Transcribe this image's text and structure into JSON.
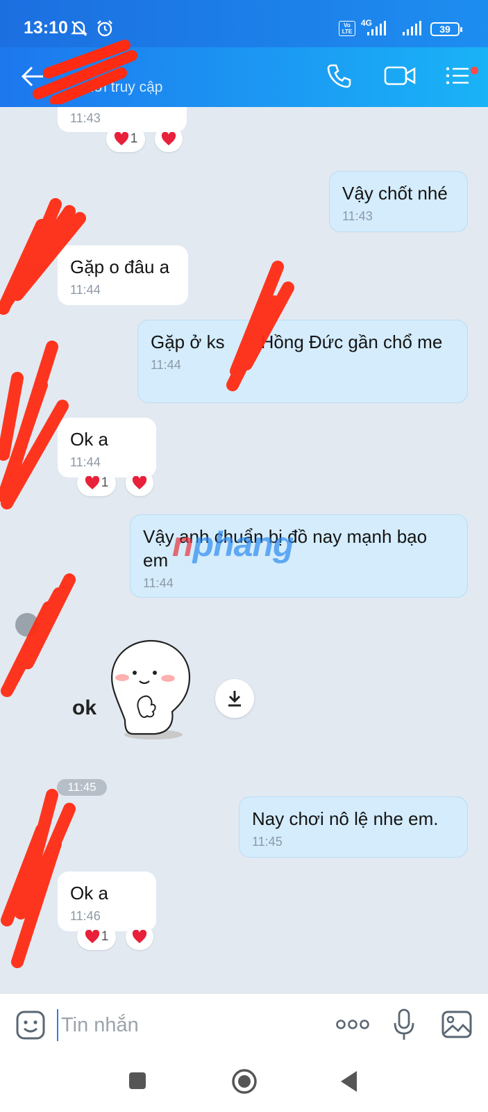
{
  "status_bar": {
    "time": "13:10",
    "network": "4G",
    "volte": "Vo LTE",
    "battery": "39"
  },
  "header": {
    "contact_name": "",
    "status": "mới truy cập"
  },
  "messages": [
    {
      "dir": "in",
      "time": "11:43",
      "reactions": {
        "count": "1"
      }
    },
    {
      "dir": "out",
      "text": "Vậy chốt nhé",
      "time": "11:43"
    },
    {
      "dir": "in",
      "text": "Gặp o đâu a",
      "time": "11:44"
    },
    {
      "dir": "out",
      "text_a": "Gặp ở ks",
      "text_b": "Hồng Đức gần chổ me",
      "time": "11:44"
    },
    {
      "dir": "in",
      "text": "Ok a",
      "time": "11:44",
      "reactions": {
        "count": "1"
      }
    },
    {
      "dir": "out",
      "text": "Vậy anh chuẩn bị đồ nay mạnh bạo em",
      "time": "11:44"
    },
    {
      "dir": "in",
      "type": "sticker",
      "sticker_text": "ok"
    },
    {
      "dir": "out",
      "text": "Nay chơi nô lệ nhe em.",
      "time": "11:45"
    },
    {
      "dir": "in",
      "text": "Ok a",
      "time": "11:46",
      "reactions": {
        "count": "1"
      }
    }
  ],
  "time_separator": "11:45",
  "watermark": {
    "part1": "n",
    "part2": "phang"
  },
  "input": {
    "placeholder": "Tin nhắn",
    "value": ""
  },
  "colors": {
    "header_start": "#1d77ee",
    "header_end": "#1ab3f7",
    "bubble_out": "#d4ecfc",
    "bubble_in": "#ffffff",
    "chat_bg": "#e2e9f1",
    "heart": "#e8203a",
    "scribble": "#ff2b12"
  }
}
